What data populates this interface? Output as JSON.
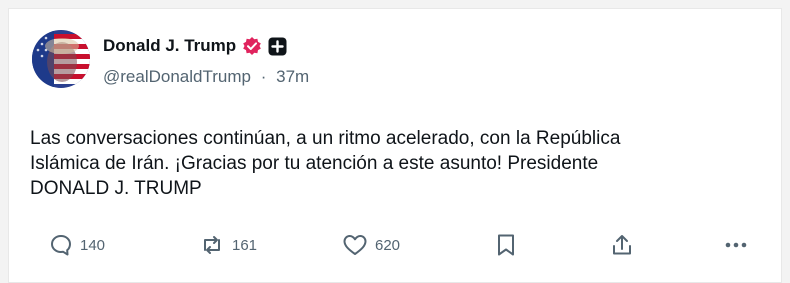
{
  "post": {
    "author_name": "Donald J. Trump",
    "handle": "@realDonaldTrump",
    "separator": "·",
    "time_ago": "37m",
    "text": "Las conversaciones continúan, a un ritmo acelerado, con la República\nIslámica de Irán. ¡Gracias por tu atención a este asunto! Presidente\nDONALD J. TRUMP",
    "verified_color": "#e0245e"
  },
  "actions": {
    "reply": {
      "icon": "reply-icon",
      "count": "140"
    },
    "repost": {
      "icon": "repost-icon",
      "count": "161"
    },
    "like": {
      "icon": "heart-icon",
      "count": "620"
    },
    "bookmark": {
      "icon": "bookmark-icon"
    },
    "share": {
      "icon": "share-icon"
    },
    "more": {
      "icon": "more-icon"
    }
  }
}
